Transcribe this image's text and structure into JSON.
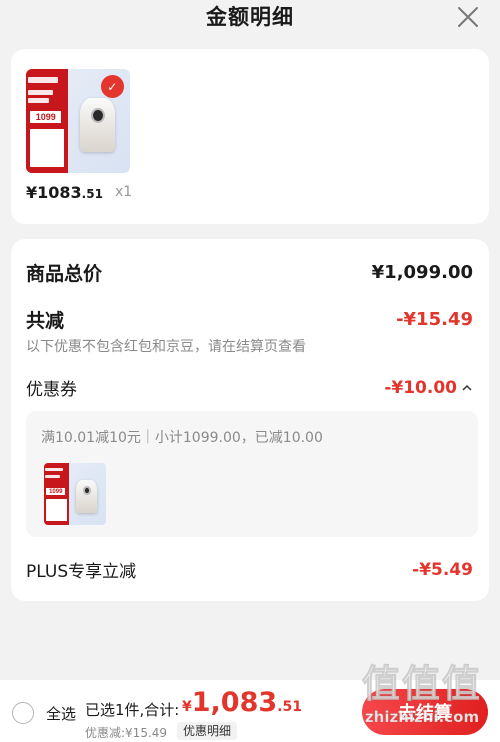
{
  "header": {
    "title": "金额明细"
  },
  "product": {
    "thumb_price": "1099",
    "price_int": "¥1083",
    "price_dec": ".51",
    "qty": "x1"
  },
  "detail": {
    "total_label": "商品总价",
    "total_value": "¥1,099.00",
    "reduce_label": "共减",
    "reduce_value": "-¥15.49",
    "hint": "以下优惠不包含红包和京豆，请在结算页查看",
    "coupon_label": "优惠券",
    "coupon_value": "-¥10.00",
    "coupon_desc": "满10.01减10元｜小计1099.00，已减10.00",
    "plus_label": "PLUS专享立减",
    "plus_value": "-¥5.49"
  },
  "bottom": {
    "select_all": "全选",
    "selected_info": "已选1件,合计:",
    "total_symbol": "¥",
    "total_int": "1,083",
    "total_dec": ".51",
    "discount_info": "优惠减:¥15.49",
    "detail_link": "优惠明细",
    "checkout": "去结算"
  },
  "watermark": {
    "line1": "值值值",
    "line2": "zhizhizhi.com"
  },
  "colors": {
    "accent": "#e2362c",
    "background": "#f2f2f2"
  }
}
